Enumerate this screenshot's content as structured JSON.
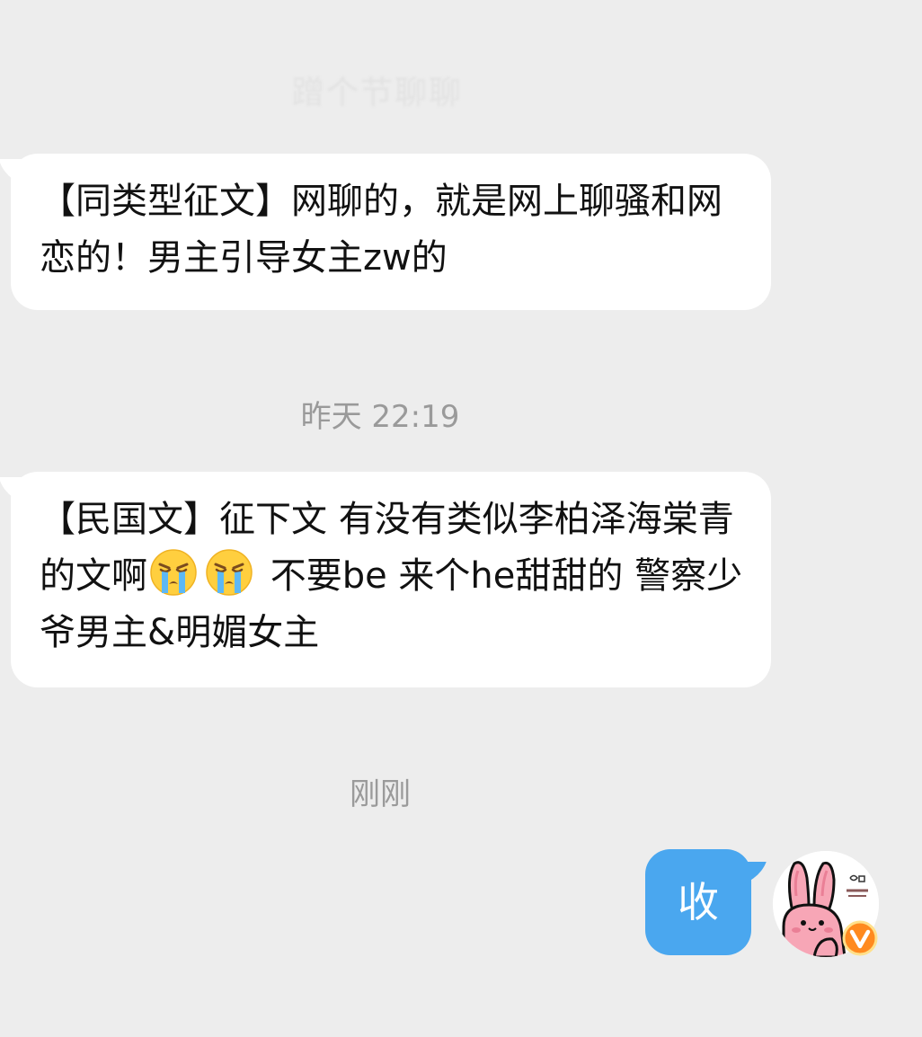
{
  "header": {
    "faded_title": "蹭个节聊聊"
  },
  "messages": [
    {
      "type": "incoming",
      "text": "【同类型征文】网聊的，就是网上聊骚和网恋的！男主引导女主zw的"
    },
    {
      "type": "timestamp",
      "text": "昨天 22:19"
    },
    {
      "type": "incoming",
      "text_before_emoji": "【民国文】征下文 有没有类似李柏泽海棠青的文啊",
      "emoji": [
        "crying-face-icon",
        "crying-face-icon"
      ],
      "text_after_emoji": " 不要be 来个he甜甜的 警察少爷男主&明媚女主"
    },
    {
      "type": "timestamp",
      "text": "刚刚"
    },
    {
      "type": "outgoing",
      "text": "收"
    }
  ],
  "avatar": {
    "icon": "pink-bunny-avatar-icon",
    "badge_icon": "vip-v-badge-icon",
    "accent": "#f7a6b6"
  },
  "colors": {
    "background": "#ededed",
    "incoming_bubble": "#ffffff",
    "outgoing_bubble": "#4aa7ef",
    "timestamp": "#9a9a9a"
  }
}
